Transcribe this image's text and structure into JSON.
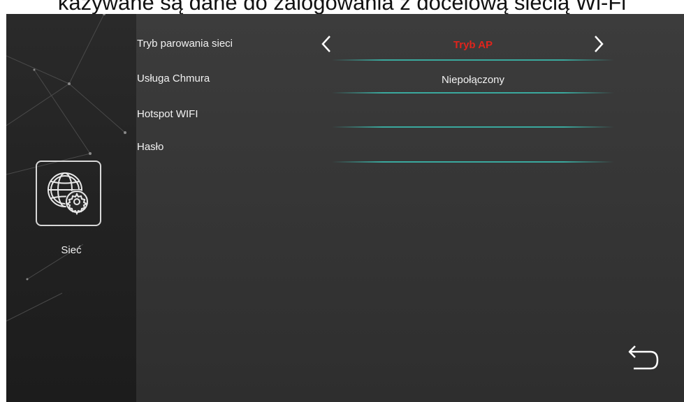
{
  "caption": "kazywane są dane do zalogowania z docelową siecią Wi-Fi",
  "sidebar": {
    "label": "Sieć",
    "icon": "network-settings-icon"
  },
  "rows": [
    {
      "label": "Tryb parowania sieci",
      "value": "Tryb AP"
    },
    {
      "label": "Usługa Chmura",
      "value": "Niepołączony"
    },
    {
      "label": "Hotspot WIFI",
      "value": ""
    },
    {
      "label": "Hasło",
      "value": ""
    }
  ],
  "colors": {
    "active_value": "#e0241c",
    "value": "#f2f2f2",
    "line": "#3aa99e",
    "sidebar": "#222222",
    "panel": "#363636"
  },
  "icons": {
    "prev": "chevron-left-icon",
    "next": "chevron-right-icon",
    "back": "return-arrow-icon"
  }
}
